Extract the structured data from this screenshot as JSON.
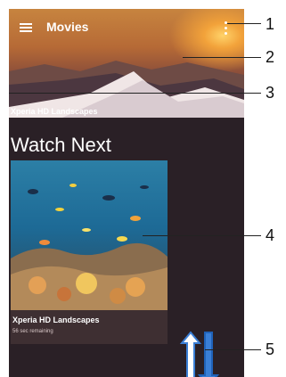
{
  "app": {
    "title": "Movies"
  },
  "hero": {
    "caption": "Xperia HD Landscapes"
  },
  "section": {
    "title": "Watch Next"
  },
  "card": {
    "title": "Xperia HD Landscapes",
    "subtitle": "56 sec remaining"
  },
  "callouts": [
    "1",
    "2",
    "3",
    "4",
    "5"
  ]
}
